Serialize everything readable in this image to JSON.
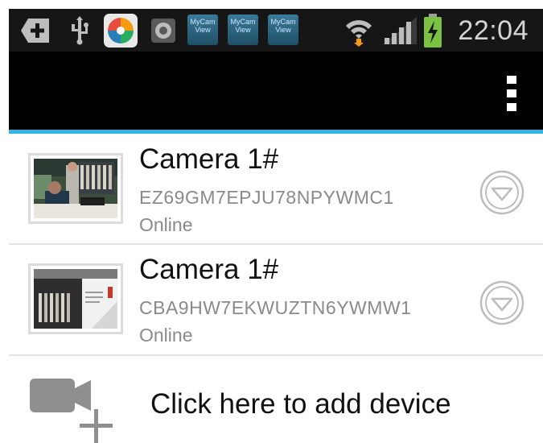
{
  "status_bar": {
    "time": "22:04",
    "notification_label": "MyCam View",
    "icons": [
      "add-box-icon",
      "usb-icon",
      "app-icon",
      "camera-app-icon",
      "mycam-view-icon",
      "mycam-view-icon",
      "mycam-view-icon",
      "wifi-icon",
      "signal-icon",
      "battery-charging-icon"
    ]
  },
  "action_bar": {
    "overflow_icon": "overflow-menu-icon"
  },
  "accent_color": "#33b5e5",
  "devices": [
    {
      "name": "Camera 1#",
      "serial": "EZ69GM7EPJU78NPYWMC1",
      "status": "Online"
    },
    {
      "name": "Camera 1#",
      "serial": "CBA9HW7EKWUZTN6YWMW1",
      "status": "Online"
    }
  ],
  "add_device": {
    "label": "Click here to add device",
    "icon": "add-camera-icon"
  }
}
